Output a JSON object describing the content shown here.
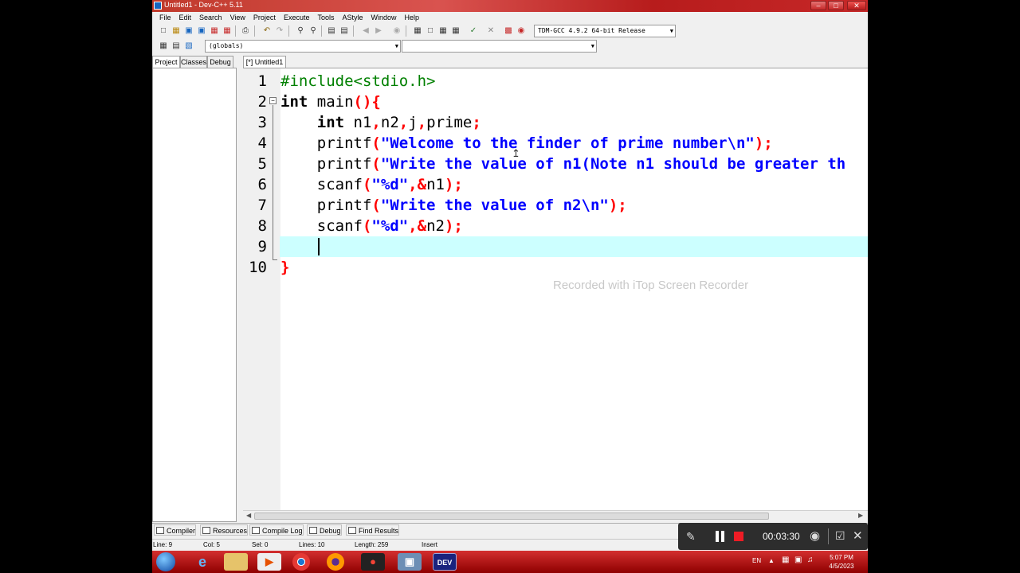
{
  "window": {
    "title": "Untitled1 - Dev-C++ 5.11"
  },
  "menu": [
    "File",
    "Edit",
    "Search",
    "View",
    "Project",
    "Execute",
    "Tools",
    "AStyle",
    "Window",
    "Help"
  ],
  "toolbar": {
    "compiler_select": "TDM-GCC 4.9.2 64-bit Release",
    "scope_select": "(globals)",
    "function_select": ""
  },
  "left_panel": {
    "tabs": [
      "Project",
      "Classes",
      "Debug"
    ],
    "active": "Project"
  },
  "editor": {
    "tab_label": "[*] Untitled1",
    "line_numbers": [
      "1",
      "2",
      "3",
      "4",
      "5",
      "6",
      "7",
      "8",
      "9",
      "10"
    ],
    "current_line": 9,
    "lines": [
      [
        [
          "pre",
          "#include<stdio.h>"
        ]
      ],
      [
        [
          "kw",
          "int"
        ],
        [
          "id",
          " main"
        ],
        [
          "punc",
          "(){"
        ]
      ],
      [
        [
          "id",
          "    "
        ],
        [
          "kw",
          "int"
        ],
        [
          "id",
          " n1"
        ],
        [
          "punc",
          ","
        ],
        [
          "id",
          "n2"
        ],
        [
          "punc",
          ","
        ],
        [
          "id",
          "j"
        ],
        [
          "punc",
          ","
        ],
        [
          "id",
          "prime"
        ],
        [
          "punc",
          ";"
        ]
      ],
      [
        [
          "id",
          "    printf"
        ],
        [
          "punc",
          "("
        ],
        [
          "str",
          "\"Welcome to the finder of prime number\\n\""
        ],
        [
          "punc",
          ");"
        ]
      ],
      [
        [
          "id",
          "    printf"
        ],
        [
          "punc",
          "("
        ],
        [
          "str",
          "\"Write the value of n1(Note n1 should be greater th"
        ]
      ],
      [
        [
          "id",
          "    scanf"
        ],
        [
          "punc",
          "("
        ],
        [
          "str",
          "\"%d\""
        ],
        [
          "punc",
          ",&"
        ],
        [
          "id",
          "n1"
        ],
        [
          "punc",
          ");"
        ]
      ],
      [
        [
          "id",
          "    printf"
        ],
        [
          "punc",
          "("
        ],
        [
          "str",
          "\"Write the value of n2\\n\""
        ],
        [
          "punc",
          ");"
        ]
      ],
      [
        [
          "id",
          "    scanf"
        ],
        [
          "punc",
          "("
        ],
        [
          "str",
          "\"%d\""
        ],
        [
          "punc",
          ",&"
        ],
        [
          "id",
          "n2"
        ],
        [
          "punc",
          ");"
        ]
      ],
      [
        [
          "id",
          "    "
        ]
      ],
      [
        [
          "punc",
          "}"
        ]
      ]
    ]
  },
  "watermark": "Recorded with iTop Screen Recorder",
  "bottom_tabs": [
    "Compiler",
    "Resources",
    "Compile Log",
    "Debug",
    "Find Results"
  ],
  "status": {
    "line": "Line:   9",
    "col": "Col:   5",
    "sel": "Sel:   0",
    "lines": "Lines:   10",
    "length": "Length:   259",
    "mode": "Insert"
  },
  "recorder": {
    "timer": "00:03:30"
  },
  "taskbar": {
    "language": "EN",
    "time": "5:07 PM",
    "date": "4/5/2023"
  },
  "colors": {
    "preprocessor": "#008000",
    "keyword": "#000000",
    "punctuation": "#ff0000",
    "string": "#0000ff",
    "current_line_bg": "#ccffff",
    "taskbar": "#c62828"
  }
}
